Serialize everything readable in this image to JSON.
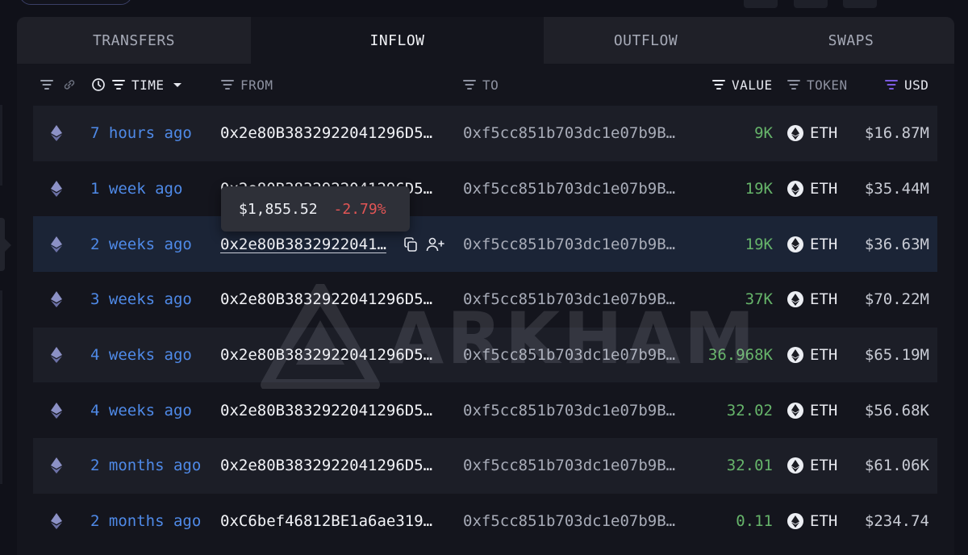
{
  "tabs": [
    "TRANSFERS",
    "INFLOW",
    "OUTFLOW",
    "SWAPS"
  ],
  "columns": {
    "time": "TIME",
    "from": "FROM",
    "to": "TO",
    "value": "VALUE",
    "token": "TOKEN",
    "usd": "USD"
  },
  "rows": [
    {
      "time": "7 hours ago",
      "from": "0x2e80B3832922041296D5…",
      "to": "0xf5cc851b703dc1e07b9B…",
      "value": "9K",
      "token": "ETH",
      "usd": "$16.87M"
    },
    {
      "time": "1 week ago",
      "from": "0x2e80B3832922041296D5…",
      "to": "0xf5cc851b703dc1e07b9B…",
      "value": "19K",
      "token": "ETH",
      "usd": "$35.44M"
    },
    {
      "time": "2 weeks ago",
      "from": "0x2e80B3832922041…",
      "to": "0xf5cc851b703dc1e07b9B…",
      "value": "19K",
      "token": "ETH",
      "usd": "$36.63M"
    },
    {
      "time": "3 weeks ago",
      "from": "0x2e80B3832922041296D5…",
      "to": "0xf5cc851b703dc1e07b9B…",
      "value": "37K",
      "token": "ETH",
      "usd": "$70.22M"
    },
    {
      "time": "4 weeks ago",
      "from": "0x2e80B3832922041296D5…",
      "to": "0xf5cc851b703dc1e07b9B…",
      "value": "36.968K",
      "token": "ETH",
      "usd": "$65.19M"
    },
    {
      "time": "4 weeks ago",
      "from": "0x2e80B3832922041296D5…",
      "to": "0xf5cc851b703dc1e07b9B…",
      "value": "32.02",
      "token": "ETH",
      "usd": "$56.68K"
    },
    {
      "time": "2 months ago",
      "from": "0x2e80B3832922041296D5…",
      "to": "0xf5cc851b703dc1e07b9B…",
      "value": "32.01",
      "token": "ETH",
      "usd": "$61.06K"
    },
    {
      "time": "2 months ago",
      "from": "0xC6bef46812BE1a6ae319…",
      "to": "0xf5cc851b703dc1e07b9B…",
      "value": "0.11",
      "token": "ETH",
      "usd": "$234.74"
    }
  ],
  "tooltip": {
    "price": "$1,855.52",
    "change": "-2.79%"
  },
  "watermark": "ARKHAM",
  "colors": {
    "time_link": "#4f8ae8",
    "value_green": "#66b46a",
    "negative_red": "#e25555",
    "usd_accent": "#7b5be0"
  }
}
